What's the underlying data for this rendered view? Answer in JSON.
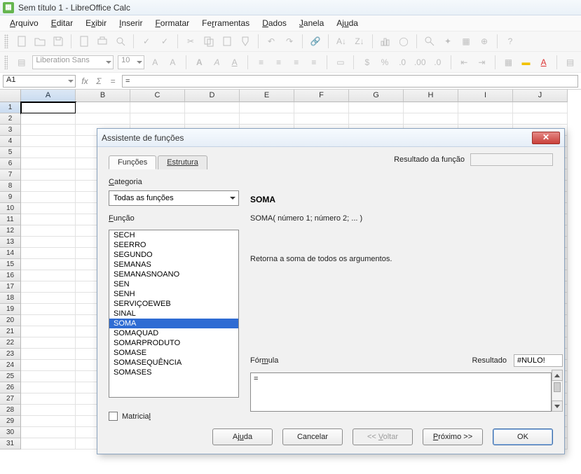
{
  "titlebar": {
    "text": "Sem título 1 - LibreOffice Calc"
  },
  "menu": {
    "file": {
      "pre": "",
      "u": "A",
      "post": "rquivo"
    },
    "edit": {
      "pre": "",
      "u": "E",
      "post": "ditar"
    },
    "view": {
      "pre": "E",
      "u": "x",
      "post": "ibir"
    },
    "insert": {
      "pre": "",
      "u": "I",
      "post": "nserir"
    },
    "format": {
      "pre": "",
      "u": "F",
      "post": "ormatar"
    },
    "tools": {
      "pre": "Fe",
      "u": "r",
      "post": "ramentas"
    },
    "data": {
      "pre": "",
      "u": "D",
      "post": "ados"
    },
    "window": {
      "pre": "",
      "u": "J",
      "post": "anela"
    },
    "help": {
      "pre": "Aj",
      "u": "u",
      "post": "da"
    }
  },
  "format_toolbar": {
    "font_name": "Liberation Sans",
    "font_size": "10"
  },
  "formula_bar": {
    "name_box": "A1",
    "input_value": "="
  },
  "sheet": {
    "columns": [
      "A",
      "B",
      "C",
      "D",
      "E",
      "F",
      "G",
      "H",
      "I",
      "J"
    ],
    "row_count": 31,
    "active": {
      "col": "A",
      "row": 1
    }
  },
  "dialog": {
    "title": "Assistente de funções",
    "tabs": {
      "functions": "Funções",
      "structure": "Estrutura"
    },
    "category_label": {
      "pre": "",
      "u": "C",
      "post": "ategoria"
    },
    "category_value": "Todas as funções",
    "function_label": {
      "pre": "",
      "u": "F",
      "post": "unção"
    },
    "functions": [
      "SECH",
      "SEERRO",
      "SEGUNDO",
      "SEMANAS",
      "SEMANASNOANO",
      "SEN",
      "SENH",
      "SERVIÇOEWEB",
      "SINAL",
      "SOMA",
      "SOMAQUAD",
      "SOMARPRODUTO",
      "SOMASE",
      "SOMASEQUÊNCIA",
      "SOMASES"
    ],
    "selected_function": "SOMA",
    "result_label": "Resultado da função",
    "detail": {
      "name": "SOMA",
      "signature": "SOMA( número 1; número 2; ...  )",
      "description": "Retorna a soma de todos os argumentos."
    },
    "formula_label": {
      "pre": "Fór",
      "u": "m",
      "post": "ula"
    },
    "result2_label": "Resultado",
    "result2_value": "#NULO!",
    "formula_value": "=",
    "matrix_label": {
      "pre": "Matricia",
      "u": "l",
      "post": ""
    },
    "buttons": {
      "help": {
        "pre": "Aj",
        "u": "u",
        "post": "da"
      },
      "cancel": "Cancelar",
      "back": {
        "pre": "<<  ",
        "u": "V",
        "post": "oltar"
      },
      "next": {
        "pre": "",
        "u": "P",
        "post": "róximo >>"
      },
      "ok": "OK"
    }
  }
}
